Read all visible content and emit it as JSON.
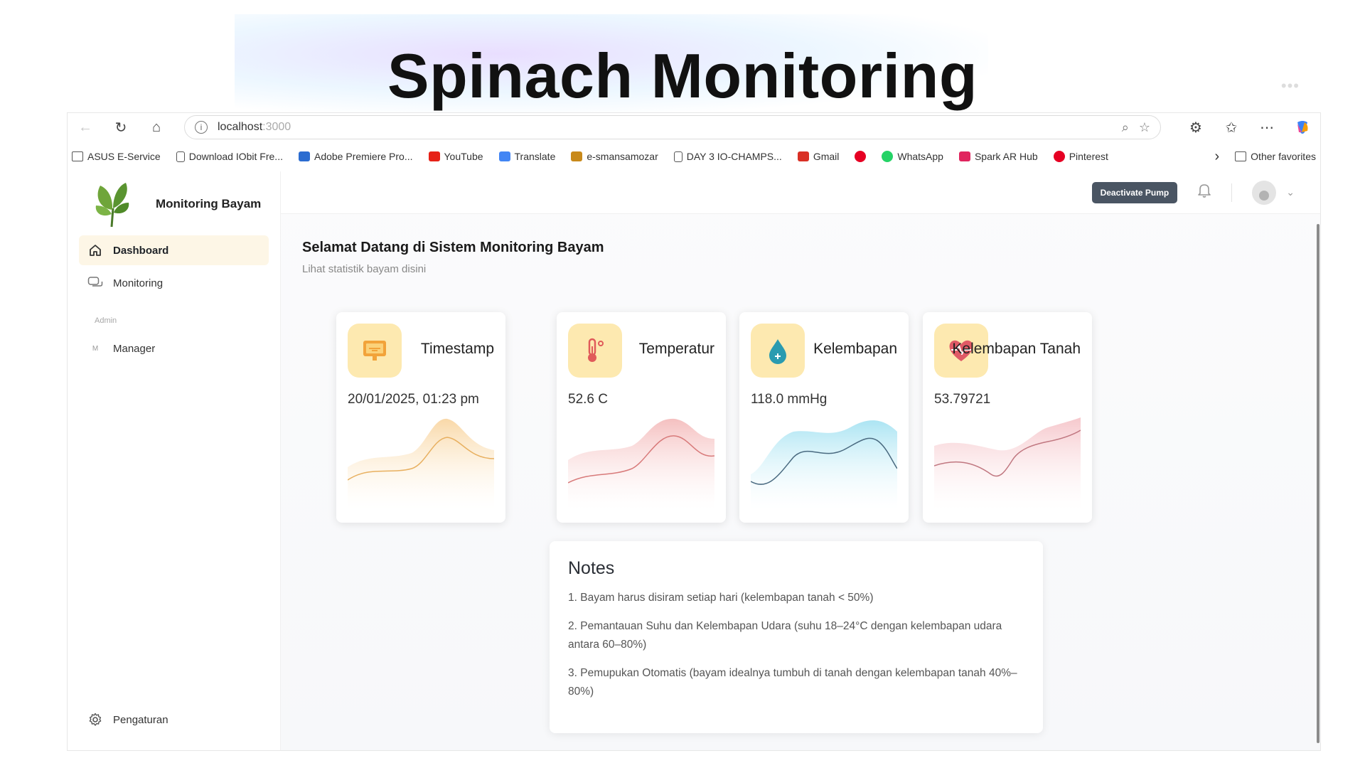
{
  "hero": {
    "title": "Spinach Monitoring"
  },
  "browser": {
    "url_host": "localhost",
    "url_port": ":3000",
    "bookmarks": [
      {
        "label": "ASUS E-Service",
        "icon": "folder-icon"
      },
      {
        "label": "Download IObit Fre...",
        "icon": "document-icon"
      },
      {
        "label": "Adobe Premiere Pro...",
        "icon": "adobe-icon",
        "color": "#2b6cd0"
      },
      {
        "label": "YouTube",
        "icon": "youtube-icon",
        "color": "#e62117"
      },
      {
        "label": "Translate",
        "icon": "translate-icon",
        "color": "#4285f4"
      },
      {
        "label": "e-smansamozar",
        "icon": "school-icon",
        "color": "#c8891a"
      },
      {
        "label": "DAY 3 IO-CHAMPS...",
        "icon": "document-icon"
      },
      {
        "label": "Gmail",
        "icon": "gmail-icon",
        "color": "#d93025"
      },
      {
        "label": "",
        "icon": "pinterest-icon",
        "color": "#e60023"
      },
      {
        "label": "WhatsApp",
        "icon": "whatsapp-icon",
        "color": "#25d366"
      },
      {
        "label": "Spark AR Hub",
        "icon": "spark-icon",
        "color": "#e0245e"
      },
      {
        "label": "Pinterest",
        "icon": "pinterest-icon",
        "color": "#e60023"
      }
    ],
    "other_favorites": "Other favorites"
  },
  "sidebar": {
    "brand": "Monitoring Bayam",
    "items": [
      {
        "label": "Dashboard",
        "icon": "home-icon",
        "active": true
      },
      {
        "label": "Monitoring",
        "icon": "chat-icon",
        "active": false
      }
    ],
    "section_label": "Admin",
    "admin_items": [
      {
        "label": "Manager",
        "letter": "M"
      }
    ],
    "settings_label": "Pengaturan"
  },
  "topbar": {
    "pump_button": "Deactivate Pump"
  },
  "welcome": {
    "title": "Selamat Datang di Sistem Monitoring Bayam",
    "subtitle": "Lihat statistik bayam disini"
  },
  "cards": [
    {
      "title": "Timestamp",
      "value": "20/01/2025, 01:23 pm",
      "icon": "monitor-icon",
      "color": "#f0b860"
    },
    {
      "title": "Temperatur",
      "value": "52.6 C",
      "icon": "thermometer-icon",
      "color": "#e88a8a"
    },
    {
      "title": "Kelembapan",
      "value": "118.0 mmHg",
      "icon": "water-drop-icon",
      "color": "#7fd4ea"
    },
    {
      "title": "Kelembapan Tanah",
      "value": "53.79721",
      "icon": "heart-pulse-icon",
      "color": "#e8909a"
    }
  ],
  "notes": {
    "title": "Notes",
    "items": [
      "1. Bayam harus disiram setiap hari (kelembapan tanah < 50%)",
      "2. Pemantauan Suhu dan Kelembapan Udara (suhu 18–24°C dengan kelembapan udara antara 60–80%)",
      "3. Pemupukan Otomatis (bayam idealnya tumbuh di tanah dengan kelembapan tanah 40%–80%)"
    ]
  }
}
